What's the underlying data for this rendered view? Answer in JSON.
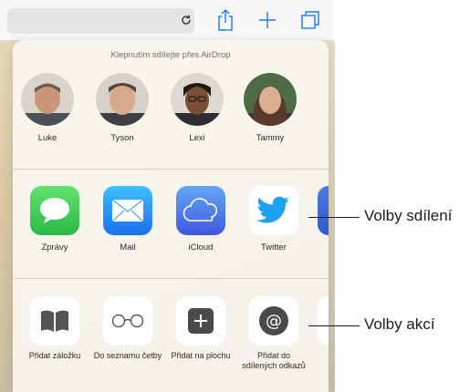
{
  "airdrop": {
    "title": "Klepnutím sdílejte přes AirDrop",
    "people": [
      "Luke",
      "Tyson",
      "Lexi",
      "Tammy"
    ]
  },
  "share_apps": [
    {
      "label": "Zprávy",
      "icon": "messages-icon"
    },
    {
      "label": "Mail",
      "icon": "mail-icon"
    },
    {
      "label": "iCloud",
      "icon": "icloud-icon"
    },
    {
      "label": "Twitter",
      "icon": "twitter-icon"
    }
  ],
  "actions": [
    {
      "label": "Přidat záložku",
      "icon": "bookmark-icon"
    },
    {
      "label": "Do seznamu četby",
      "icon": "reading-list-icon"
    },
    {
      "label": "Přidat na plochu",
      "icon": "add-to-home-icon"
    },
    {
      "label": "Přidat do sdílených odkazů",
      "icon": "shared-links-icon"
    }
  ],
  "callouts": {
    "share": "Volby sdílení",
    "actions": "Volby akcí"
  },
  "colors": {
    "accent": "#1a7cf2",
    "messages": "#34c759",
    "mail": "#1e88f5",
    "icloud": "#4f7df2",
    "twitter": "#1da1f2"
  }
}
